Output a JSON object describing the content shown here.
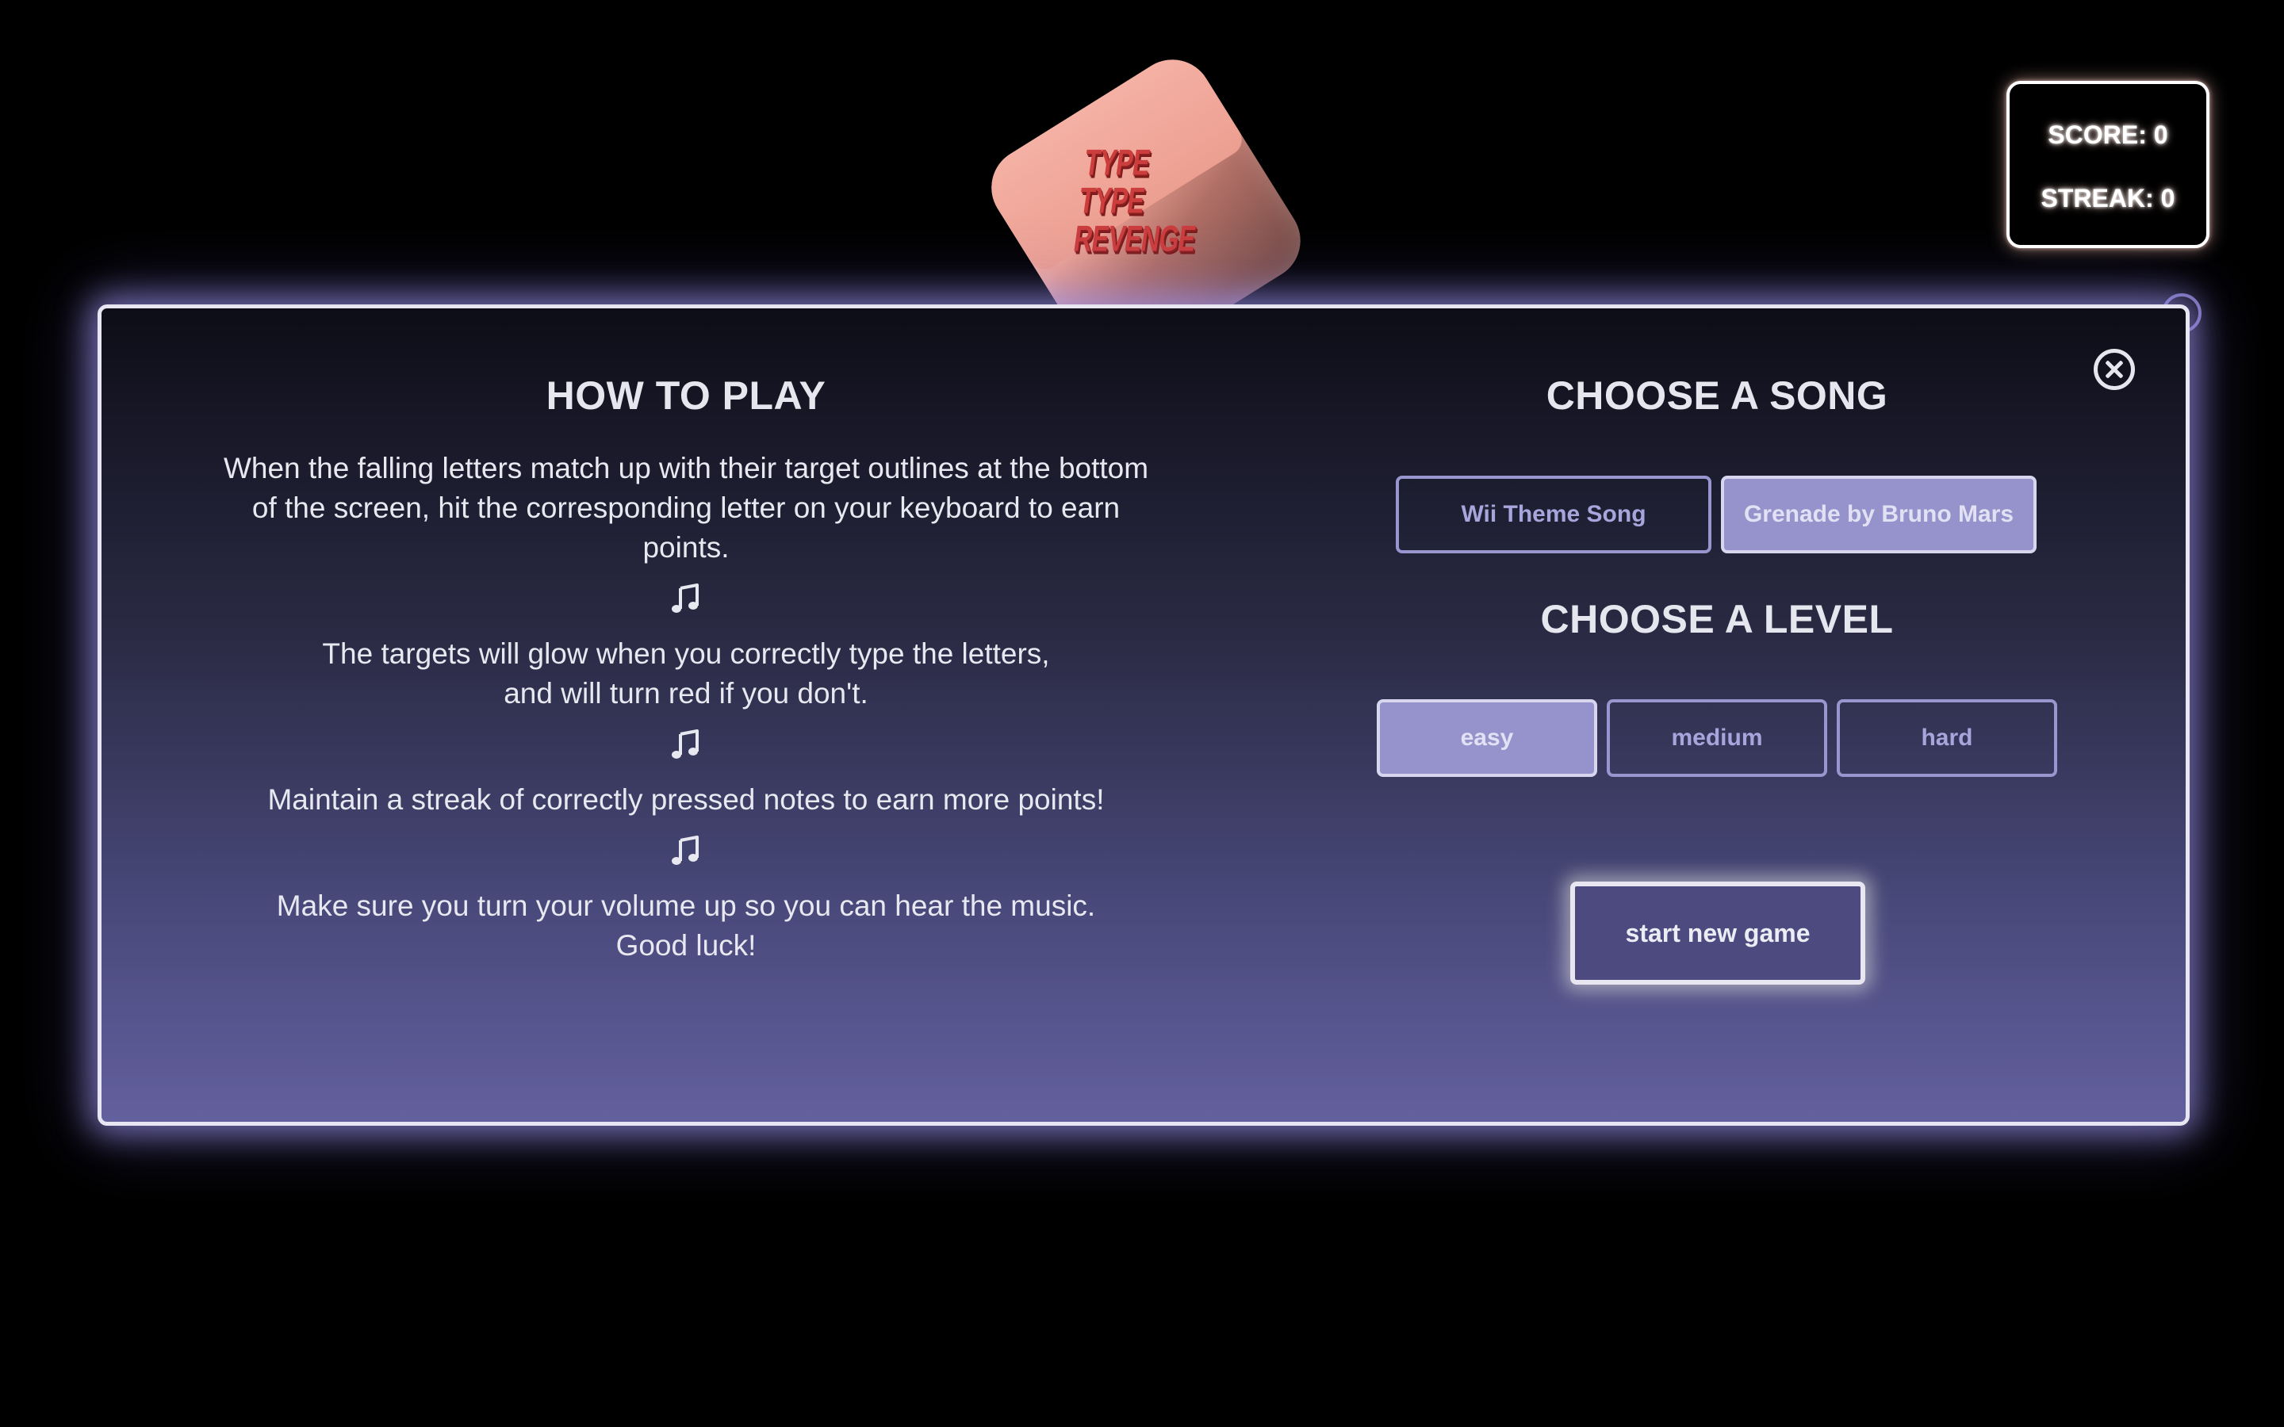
{
  "logo": {
    "line1": "TYPE",
    "line2": "TYPE",
    "line3": "REVENGE"
  },
  "scoreboard": {
    "score": "SCORE: 0",
    "streak": "STREAK: 0"
  },
  "how_to_play": {
    "title": "HOW TO PLAY",
    "paragraph1": "When the falling letters match up with their target outlines at the bottom of the screen, hit the corresponding letter on your keyboard to earn points.",
    "paragraph2_line1": "The targets will glow when you correctly type the letters,",
    "paragraph2_line2": "and will turn red if you don't.",
    "paragraph3": "Maintain a streak of correctly pressed notes to earn more points!",
    "paragraph4_line1": "Make sure you turn your volume up so you can hear the music.",
    "paragraph4_line2": "Good luck!",
    "divider_icon": "music-note-icon"
  },
  "song_select": {
    "title": "CHOOSE A SONG",
    "options": [
      {
        "label": "Wii Theme Song",
        "selected": false
      },
      {
        "label": "Grenade by Bruno Mars",
        "selected": true
      }
    ]
  },
  "level_select": {
    "title": "CHOOSE A LEVEL",
    "options": [
      {
        "label": "easy",
        "selected": true
      },
      {
        "label": "medium",
        "selected": false
      },
      {
        "label": "hard",
        "selected": false
      }
    ]
  },
  "actions": {
    "start_label": "start new game",
    "close_icon": "close-icon"
  },
  "colors": {
    "background": "#000000",
    "panel_border": "#e9e6f3",
    "panel_glow": "#a096f0",
    "button_accent": "#9895cf",
    "selected_fill": "#9592cc",
    "logo_red": "#cc3d3d",
    "cube_pink": "#f5b3a6"
  }
}
